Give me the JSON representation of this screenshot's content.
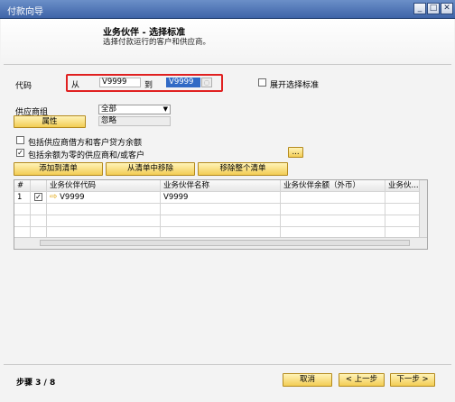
{
  "window": {
    "title": "付款向导"
  },
  "header": {
    "title": "业务伙伴 - 选择标准",
    "subtitle": "选择付款运行的客户和供应商。"
  },
  "form": {
    "code_label": "代码",
    "from_label": "从",
    "from_value": "V9999",
    "to_label": "到",
    "to_value": "V9999",
    "expand_label": "展开选择标准",
    "vendor_group_label": "供应商组",
    "vendor_group_value": "全部",
    "properties_button": "属性",
    "properties_value": "忽略",
    "include_debit_label": "包括供应商借方和客户贷方余额",
    "include_zero_label": "包括余额为零的供应商和/或客户",
    "include_debit_checked": false,
    "include_zero_checked": true,
    "more_button": "..."
  },
  "actions": {
    "add_to_list": "添加到清单",
    "remove_from_list": "从清单中移除",
    "remove_all": "移除整个清单"
  },
  "grid": {
    "columns": [
      "#",
      "",
      "业务伙伴代码",
      "业务伙伴名称",
      "业务伙伴余额（外币）",
      "业务伙..."
    ],
    "rows": [
      {
        "num": "1",
        "checked": true,
        "code": "V9999",
        "name": "V9999",
        "balance": "",
        "extra": ""
      }
    ]
  },
  "footer": {
    "step": "步骤 3 / 8",
    "cancel": "取消",
    "prev": "< 上一步",
    "next": "下一步 >"
  },
  "colors": {
    "accent_yellow": "#f3cd54",
    "title_bar": "#3e64a8",
    "highlight": "#e02020"
  }
}
